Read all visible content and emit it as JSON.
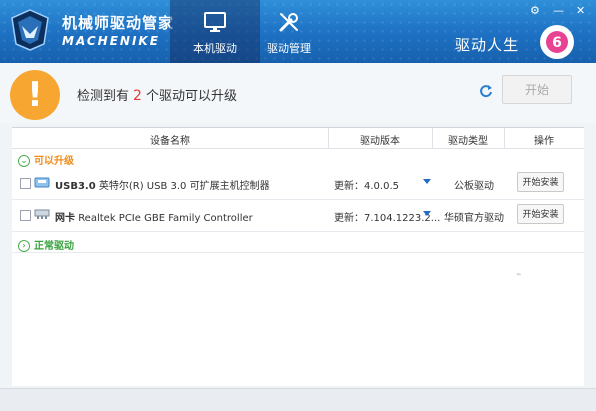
{
  "app": {
    "title_cn": "机械师驱动管家",
    "title_en": "MACHENIKE",
    "slogan": "驱动人生",
    "slogan_badge": "6",
    "window_controls": [
      "⚙",
      "—",
      "✕"
    ]
  },
  "tabs": [
    {
      "label": "本机驱动",
      "icon": "monitor-icon",
      "active": true
    },
    {
      "label": "驱动管理",
      "icon": "tools-icon",
      "active": false
    }
  ],
  "status": {
    "prefix": "检测到有",
    "count": "2",
    "suffix": "个驱动可以升级",
    "start_label": "开始"
  },
  "table": {
    "headers": [
      "设备名称",
      "驱动版本",
      "驱动类型",
      "操作"
    ]
  },
  "groups": {
    "upgradable": "可以升级",
    "normal": "正常驱动"
  },
  "drivers": [
    {
      "icon": "usb-icon",
      "name_bold": "USB3.0",
      "name": "英特尔(R) USB 3.0 可扩展主机控制器",
      "version_label": "更新：",
      "version": "4.0.0.5",
      "type": "公板驱动",
      "action": "开始安装"
    },
    {
      "icon": "network-card-icon",
      "name_bold": "网卡",
      "name": "Realtek PCIe GBE Family Controller",
      "version_label": "更新：",
      "version": "7.104.1223.2...",
      "type": "华硕官方驱动",
      "action": "开始安装"
    }
  ],
  "colors": {
    "header": "#1d70c2",
    "accent_orange": "#f7a632",
    "group_orange": "#f08c1a",
    "group_green": "#3aa33f",
    "count_red": "#e53935"
  }
}
